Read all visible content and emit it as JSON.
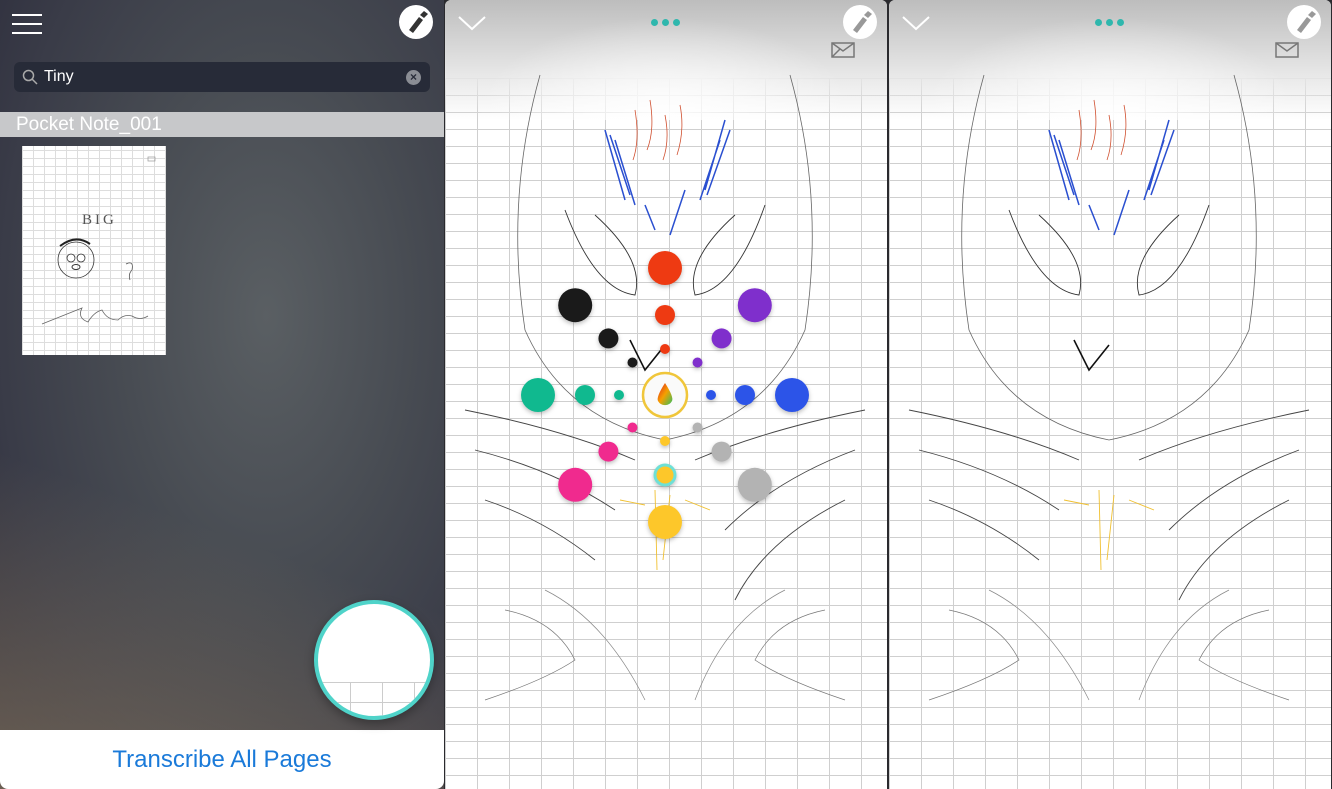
{
  "sidebar": {
    "menu_icon": "hamburger-icon",
    "pen_icon": "pen-icon",
    "search": {
      "value": "Tiny",
      "placeholder": "Search"
    },
    "section_title": "Pocket Note_001",
    "thumbnail": {
      "label_big": "BIG"
    },
    "footer_button": "Transcribe All Pages"
  },
  "pages": [
    {
      "icons": [
        "chevron-down-icon",
        "more-dots-icon",
        "pen-icon",
        "mail-icon"
      ],
      "color_picker_open": true
    },
    {
      "icons": [
        "chevron-down-icon",
        "more-dots-icon",
        "pen-icon",
        "mail-icon"
      ],
      "color_picker_open": false
    }
  ],
  "colors": {
    "accent": "#2fb7ad",
    "link": "#1a7ad9",
    "palette": [
      "#ee3a12",
      "#7f2fcc",
      "#2c54e8",
      "#b3b3b3",
      "#fdc72a",
      "#f02a8e",
      "#10b98f",
      "#1a1a1a"
    ],
    "selected": "#fdc72a"
  }
}
